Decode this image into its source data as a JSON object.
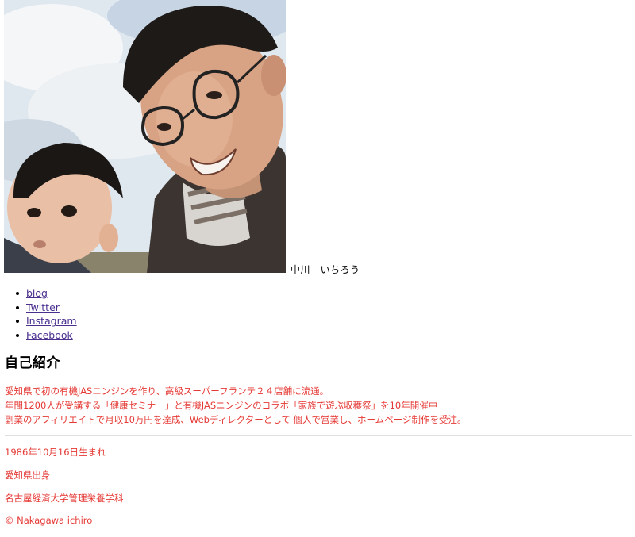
{
  "header": {
    "photo_alt": "profile photo",
    "owner_name": "中川　いちろう"
  },
  "nav": {
    "items": [
      {
        "label": "blog"
      },
      {
        "label": "Twitter"
      },
      {
        "label": "Instagram"
      },
      {
        "label": "Facebook"
      }
    ]
  },
  "intro": {
    "title": "自己紹介",
    "lines": [
      "愛知県で初の有機JASニンジンを作り、高級スーパーフランテ２４店舗に流通。",
      "年間1200人が受講する「健康セミナー」と有機JASニンジンのコラボ「家族で遊ぶ収穫祭」を10年開催中",
      "副業のアフィリエイトで月収10万円を達成、Webディレクターとして 個人で営業し、ホームページ制作を受注。"
    ]
  },
  "facts": {
    "birth": "1986年10月16日生まれ",
    "hometown": "愛知県出身",
    "school": "名古屋経済大学管理栄養学科"
  },
  "footer": {
    "copyright": "© Nakagawa ichiro"
  },
  "colors": {
    "accent_text": "#e53935",
    "link": "#4a2f8e",
    "divider": "#9a9a9a"
  }
}
